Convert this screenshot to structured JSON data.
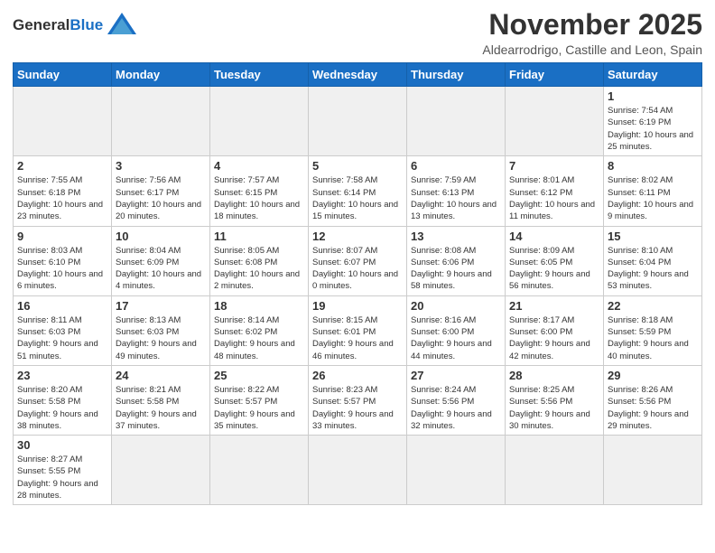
{
  "header": {
    "logo_text_general": "General",
    "logo_text_blue": "Blue",
    "month_title": "November 2025",
    "location": "Aldearrodrigo, Castille and Leon, Spain"
  },
  "weekdays": [
    "Sunday",
    "Monday",
    "Tuesday",
    "Wednesday",
    "Thursday",
    "Friday",
    "Saturday"
  ],
  "weeks": [
    [
      {
        "day": "",
        "info": ""
      },
      {
        "day": "",
        "info": ""
      },
      {
        "day": "",
        "info": ""
      },
      {
        "day": "",
        "info": ""
      },
      {
        "day": "",
        "info": ""
      },
      {
        "day": "",
        "info": ""
      },
      {
        "day": "1",
        "info": "Sunrise: 7:54 AM\nSunset: 6:19 PM\nDaylight: 10 hours\nand 25 minutes."
      }
    ],
    [
      {
        "day": "2",
        "info": "Sunrise: 7:55 AM\nSunset: 6:18 PM\nDaylight: 10 hours\nand 23 minutes."
      },
      {
        "day": "3",
        "info": "Sunrise: 7:56 AM\nSunset: 6:17 PM\nDaylight: 10 hours\nand 20 minutes."
      },
      {
        "day": "4",
        "info": "Sunrise: 7:57 AM\nSunset: 6:15 PM\nDaylight: 10 hours\nand 18 minutes."
      },
      {
        "day": "5",
        "info": "Sunrise: 7:58 AM\nSunset: 6:14 PM\nDaylight: 10 hours\nand 15 minutes."
      },
      {
        "day": "6",
        "info": "Sunrise: 7:59 AM\nSunset: 6:13 PM\nDaylight: 10 hours\nand 13 minutes."
      },
      {
        "day": "7",
        "info": "Sunrise: 8:01 AM\nSunset: 6:12 PM\nDaylight: 10 hours\nand 11 minutes."
      },
      {
        "day": "8",
        "info": "Sunrise: 8:02 AM\nSunset: 6:11 PM\nDaylight: 10 hours\nand 9 minutes."
      }
    ],
    [
      {
        "day": "9",
        "info": "Sunrise: 8:03 AM\nSunset: 6:10 PM\nDaylight: 10 hours\nand 6 minutes."
      },
      {
        "day": "10",
        "info": "Sunrise: 8:04 AM\nSunset: 6:09 PM\nDaylight: 10 hours\nand 4 minutes."
      },
      {
        "day": "11",
        "info": "Sunrise: 8:05 AM\nSunset: 6:08 PM\nDaylight: 10 hours\nand 2 minutes."
      },
      {
        "day": "12",
        "info": "Sunrise: 8:07 AM\nSunset: 6:07 PM\nDaylight: 10 hours\nand 0 minutes."
      },
      {
        "day": "13",
        "info": "Sunrise: 8:08 AM\nSunset: 6:06 PM\nDaylight: 9 hours\nand 58 minutes."
      },
      {
        "day": "14",
        "info": "Sunrise: 8:09 AM\nSunset: 6:05 PM\nDaylight: 9 hours\nand 56 minutes."
      },
      {
        "day": "15",
        "info": "Sunrise: 8:10 AM\nSunset: 6:04 PM\nDaylight: 9 hours\nand 53 minutes."
      }
    ],
    [
      {
        "day": "16",
        "info": "Sunrise: 8:11 AM\nSunset: 6:03 PM\nDaylight: 9 hours\nand 51 minutes."
      },
      {
        "day": "17",
        "info": "Sunrise: 8:13 AM\nSunset: 6:03 PM\nDaylight: 9 hours\nand 49 minutes."
      },
      {
        "day": "18",
        "info": "Sunrise: 8:14 AM\nSunset: 6:02 PM\nDaylight: 9 hours\nand 48 minutes."
      },
      {
        "day": "19",
        "info": "Sunrise: 8:15 AM\nSunset: 6:01 PM\nDaylight: 9 hours\nand 46 minutes."
      },
      {
        "day": "20",
        "info": "Sunrise: 8:16 AM\nSunset: 6:00 PM\nDaylight: 9 hours\nand 44 minutes."
      },
      {
        "day": "21",
        "info": "Sunrise: 8:17 AM\nSunset: 6:00 PM\nDaylight: 9 hours\nand 42 minutes."
      },
      {
        "day": "22",
        "info": "Sunrise: 8:18 AM\nSunset: 5:59 PM\nDaylight: 9 hours\nand 40 minutes."
      }
    ],
    [
      {
        "day": "23",
        "info": "Sunrise: 8:20 AM\nSunset: 5:58 PM\nDaylight: 9 hours\nand 38 minutes."
      },
      {
        "day": "24",
        "info": "Sunrise: 8:21 AM\nSunset: 5:58 PM\nDaylight: 9 hours\nand 37 minutes."
      },
      {
        "day": "25",
        "info": "Sunrise: 8:22 AM\nSunset: 5:57 PM\nDaylight: 9 hours\nand 35 minutes."
      },
      {
        "day": "26",
        "info": "Sunrise: 8:23 AM\nSunset: 5:57 PM\nDaylight: 9 hours\nand 33 minutes."
      },
      {
        "day": "27",
        "info": "Sunrise: 8:24 AM\nSunset: 5:56 PM\nDaylight: 9 hours\nand 32 minutes."
      },
      {
        "day": "28",
        "info": "Sunrise: 8:25 AM\nSunset: 5:56 PM\nDaylight: 9 hours\nand 30 minutes."
      },
      {
        "day": "29",
        "info": "Sunrise: 8:26 AM\nSunset: 5:56 PM\nDaylight: 9 hours\nand 29 minutes."
      }
    ],
    [
      {
        "day": "30",
        "info": "Sunrise: 8:27 AM\nSunset: 5:55 PM\nDaylight: 9 hours\nand 28 minutes."
      },
      {
        "day": "",
        "info": ""
      },
      {
        "day": "",
        "info": ""
      },
      {
        "day": "",
        "info": ""
      },
      {
        "day": "",
        "info": ""
      },
      {
        "day": "",
        "info": ""
      },
      {
        "day": "",
        "info": ""
      }
    ]
  ]
}
